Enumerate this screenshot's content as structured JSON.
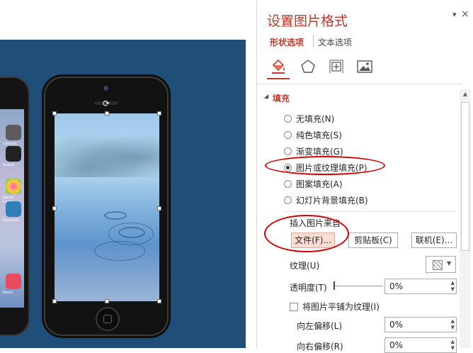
{
  "panel": {
    "title": "设置图片格式",
    "pin_glyph": "▾",
    "close_glyph": "×",
    "tabs": [
      {
        "label": "形状选项",
        "active": true
      },
      {
        "label": "文本选项",
        "active": false
      }
    ],
    "icon_tabs": [
      "fill-line-icon",
      "effects-pentagon-icon",
      "size-properties-icon",
      "picture-icon"
    ],
    "section_title": "填充",
    "fill_options": [
      {
        "label": "无填充(N)",
        "checked": false
      },
      {
        "label": "纯色填充(S)",
        "checked": false
      },
      {
        "label": "渐变填充(G)",
        "checked": false
      },
      {
        "label": "图片或纹理填充(P)",
        "checked": true
      },
      {
        "label": "图案填充(A)",
        "checked": false
      },
      {
        "label": "幻灯片背景填充(B)",
        "checked": false
      }
    ],
    "insert_from_label": "插入图片来自",
    "buttons": {
      "file": "文件(F)...",
      "clipboard": "剪贴板(C)",
      "online": "联机(E)..."
    },
    "texture_label": "纹理(U)",
    "transparency_label": "透明度(T)",
    "transparency_value": "0%",
    "tile_label": "将图片平铺为纹理(I)",
    "tile_checked": false,
    "offset_left_label": "向左偏移(L)",
    "offset_left_value": "0%",
    "offset_right_label": "向右偏移(R)",
    "offset_right_value": "0%"
  },
  "colors": {
    "accent": "#c0392b",
    "slide_bg": "#1f4e79",
    "annotation": "#d80000",
    "file_button_bg": "#fbdcd3"
  },
  "canvas": {
    "left_phone_labels": [
      "Camera",
      "Videos",
      "Game Center",
      "Passbook",
      "Music"
    ]
  }
}
